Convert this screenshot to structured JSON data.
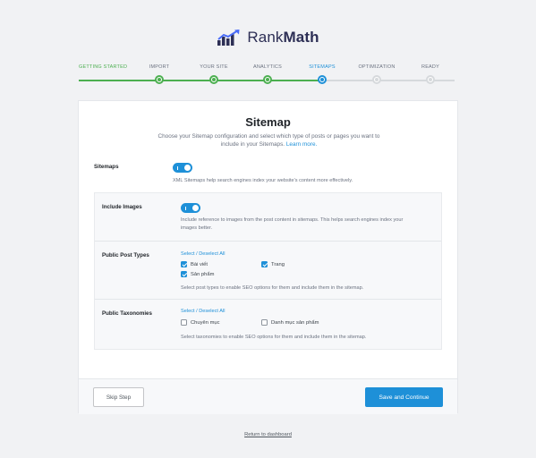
{
  "brand": {
    "name_light": "Rank",
    "name_bold": "Math"
  },
  "steps": [
    {
      "label": "GETTING STARTED",
      "state": "done"
    },
    {
      "label": "IMPORT",
      "state": "done"
    },
    {
      "label": "YOUR SITE",
      "state": "done"
    },
    {
      "label": "ANALYTICS",
      "state": "done"
    },
    {
      "label": "SITEMAPS",
      "state": "current"
    },
    {
      "label": "OPTIMIZATION",
      "state": "todo"
    },
    {
      "label": "READY",
      "state": "todo"
    }
  ],
  "card": {
    "title": "Sitemap",
    "description_line1": "Choose your Sitemap configuration and select which type of posts or pages you want to",
    "description_line2": "include in your Sitemaps.",
    "learn_more": "Learn more."
  },
  "sitemaps": {
    "label": "Sitemaps",
    "enabled": true,
    "help": "XML Sitemaps help search engines index your website's content more effectively."
  },
  "include_images": {
    "label": "Include Images",
    "enabled": true,
    "help_line1": "Include reference to images from the post content in sitemaps. This helps search engines index your",
    "help_line2": "images better."
  },
  "post_types": {
    "label": "Public Post Types",
    "select_all": "Select / Deselect All",
    "items": [
      {
        "label": "Bài viết",
        "checked": true
      },
      {
        "label": "Trang",
        "checked": true
      },
      {
        "label": "Sản phẩm",
        "checked": true
      }
    ],
    "help": "Select post types to enable SEO options for them and include them in the sitemap."
  },
  "taxonomies": {
    "label": "Public Taxonomies",
    "select_all": "Select / Deselect All",
    "items": [
      {
        "label": "Chuyên mục",
        "checked": false
      },
      {
        "label": "Danh mục sản phẩm",
        "checked": false
      }
    ],
    "help": "Select taxonomies to enable SEO options for them and include them in the sitemap."
  },
  "footer": {
    "skip_label": "Skip Step",
    "save_label": "Save and Continue"
  },
  "return_link": "Return to dashboard",
  "colors": {
    "accent": "#1e90d8",
    "done": "#4caf50",
    "pending": "#d6d9dc",
    "brand": "#2d2f55"
  }
}
